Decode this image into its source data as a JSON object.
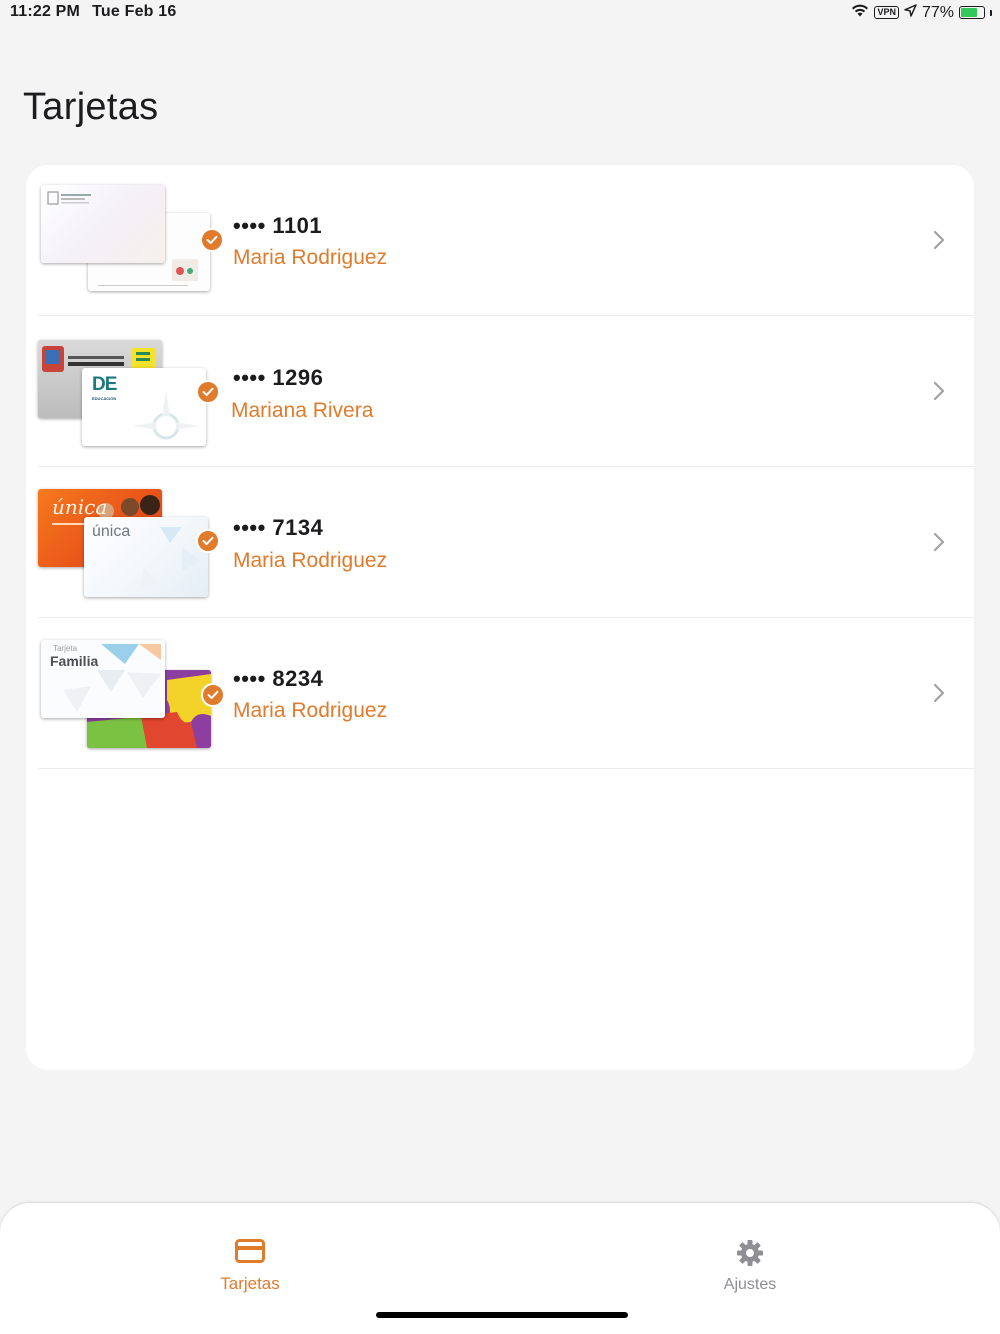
{
  "status_bar": {
    "time": "11:22 PM",
    "date": "Tue Feb 16",
    "vpn": "VPN",
    "battery_percent": "77%",
    "battery_level": 0.77
  },
  "page": {
    "title": "Tarjetas"
  },
  "cards": [
    {
      "number": "•••• 1101",
      "holder": "Maria Rodriguez",
      "selected": true
    },
    {
      "number": "•••• 1296",
      "holder": "Mariana Rivera",
      "selected": true
    },
    {
      "number": "•••• 7134",
      "holder": "Maria Rodriguez",
      "selected": true
    },
    {
      "number": "•••• 8234",
      "holder": "Maria Rodriguez",
      "selected": true
    }
  ],
  "card_art": {
    "de_logo": "DE",
    "de_caption": "EDUCACIÓN",
    "unica_front": "única",
    "unica_back": "única",
    "familia_small": "Tarjeta",
    "familia_big": "Familia"
  },
  "tab_bar": {
    "tabs": [
      {
        "label": "Tarjetas",
        "icon": "credit-card-icon",
        "active": true
      },
      {
        "label": "Ajustes",
        "icon": "gear-icon",
        "active": false
      }
    ]
  },
  "colors": {
    "accent": "#e07b2c",
    "background": "#f4f4f5",
    "panel": "#ffffff",
    "inactive": "#8e8e93"
  }
}
